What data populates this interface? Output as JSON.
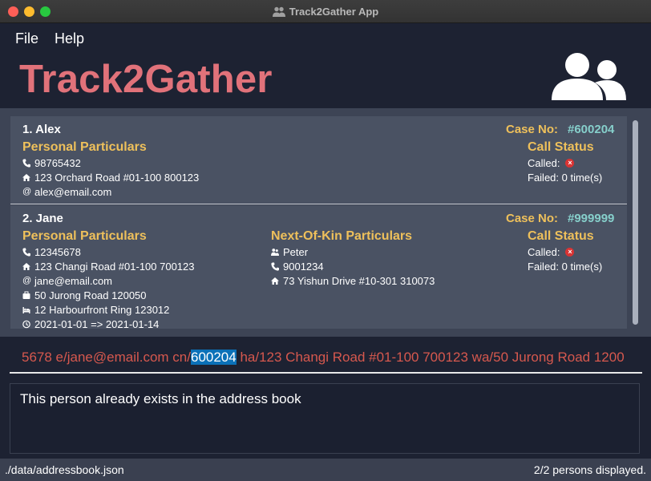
{
  "window": {
    "title": "Track2Gather App"
  },
  "menu": {
    "items": [
      "File",
      "Help"
    ]
  },
  "header": {
    "app_name": "Track2Gather"
  },
  "persons": [
    {
      "index_name": "1.  Alex",
      "case_label": "Case No:",
      "case_no": "#600204",
      "personal_title": "Personal Particulars",
      "phone": "98765432",
      "home_address": "123 Orchard Road #01-100 800123",
      "email": "alex@email.com",
      "call_title": "Call Status",
      "called_label": "Called:",
      "failed": "Failed: 0 time(s)"
    },
    {
      "index_name": "2.  Jane",
      "case_label": "Case No:",
      "case_no": "#999999",
      "personal_title": "Personal Particulars",
      "phone": "12345678",
      "home_address": "123 Changi Road #01-100 700123",
      "email": "jane@email.com",
      "work_address": "50 Jurong Road 120050",
      "quarantine_address": "12 Harbourfront Ring 123012",
      "shn_period": "2021-01-01 => 2021-01-14",
      "kin_title": "Next-Of-Kin Particulars",
      "kin_name": "Peter",
      "kin_phone": "9001234",
      "kin_address": "73 Yishun Drive #10-301 310073",
      "call_title": "Call Status",
      "called_label": "Called:",
      "failed": "Failed: 0 time(s)"
    }
  ],
  "command": {
    "before": "5678 e/jane@email.com cn/",
    "selected": "600204",
    "after": " ha/123 Changi Road #01-100 700123 wa/50 Jurong Road 1200"
  },
  "result": {
    "message": "This person already exists in the address book"
  },
  "status": {
    "file_path": "./data/addressbook.json",
    "count": "2/2 persons displayed."
  },
  "colors": {
    "accent_red": "#e1727a",
    "gold": "#eec05b",
    "teal": "#86cfcb",
    "command_text": "#d6584e",
    "selection": "#0b71b8"
  }
}
